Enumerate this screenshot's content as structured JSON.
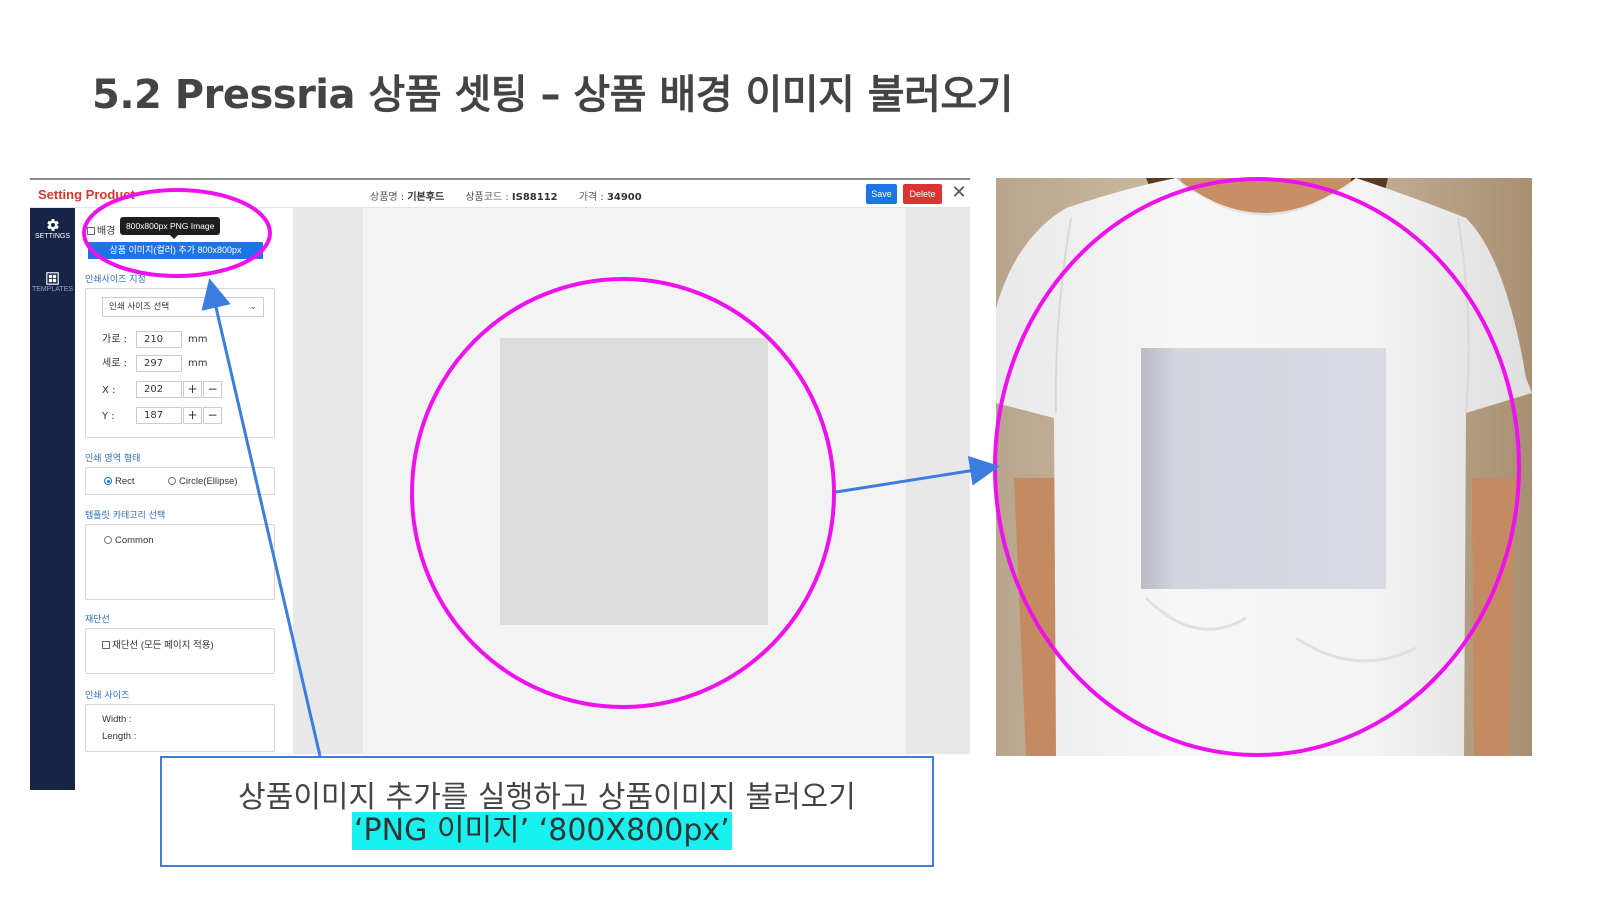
{
  "slide": {
    "title": "5.2  Pressria 상품 셋팅 – 상품 배경 이미지 불러오기"
  },
  "app": {
    "title": "Setting Product",
    "product_name_label": "상품명 :",
    "product_name": "기본후드",
    "product_code_label": "상품코드 :",
    "product_code": "IS88112",
    "price_label": "가격 :",
    "price": "34900",
    "save_label": "Save",
    "delete_label": "Delete",
    "close_glyph": "✕",
    "nav": [
      {
        "label": "SETTINGS",
        "icon": "gear-icon"
      },
      {
        "label": "TEMPLATES",
        "icon": "templates-icon"
      }
    ],
    "panel": {
      "bg_checkbox_label": "배경",
      "tooltip": "800x800px PNG Image",
      "add_image_button": "상품 이미지(컬러) 추가 800x800px",
      "print_size_setting_label": "인쇄사이즈 지정",
      "print_size_select": "인쇄 사이즈 선택",
      "width_label": "가로 :",
      "width_value": "210",
      "width_unit": "mm",
      "height_label": "세로 :",
      "height_value": "297",
      "height_unit": "mm",
      "x_label": "X :",
      "x_value": "202",
      "y_label": "Y :",
      "y_value": "187",
      "plus": "+",
      "minus": "−",
      "print_area_shape_label": "인쇄 영역 형태",
      "shape_rect": "Rect",
      "shape_circle": "Circle(Ellipse)",
      "template_category_label": "템플릿 카테고리 선택",
      "category_common": "Common",
      "cutline_label": "재단선",
      "cutline_option": "재단선 (모든 페이지 적용)",
      "print_size_label": "인쇄 사이즈",
      "print_width_label": "Width :",
      "print_length_label": "Length :"
    }
  },
  "callout": {
    "line1": "상품이미지 추가를 실행하고 상품이미지 불러오기",
    "line2": "‘PNG 이미지’ ‘800X800px’"
  },
  "colors": {
    "highlight_magenta": "#ee11ee",
    "arrow_blue": "#3b7ee0",
    "nav_dark": "#182447",
    "primary_blue": "#1d74e8",
    "delete_red": "#dd3333",
    "title_red": "#d33a2c",
    "callout_highlight": "#19f0f0"
  }
}
